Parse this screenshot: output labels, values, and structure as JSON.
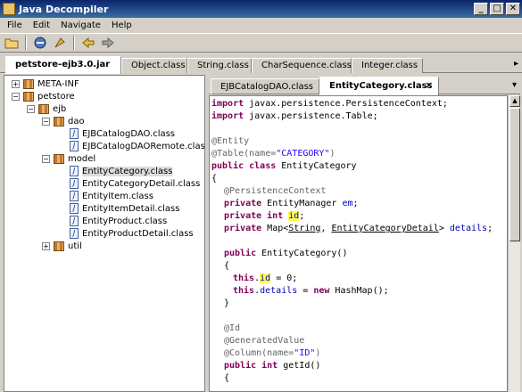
{
  "window": {
    "title": "Java Decompiler",
    "buttons": [
      "_",
      "□",
      "✕"
    ]
  },
  "menu": [
    "File",
    "Edit",
    "Navigate",
    "Help"
  ],
  "toolbar_icons": [
    "open-file-icon",
    "save-icon",
    "search-icon",
    "back-icon",
    "forward-icon"
  ],
  "file_tabs": [
    "petstore-ejb3.0.jar",
    "Object.class",
    "String.class",
    "CharSequence.class",
    "Integer.class"
  ],
  "tree": {
    "meta_inf": "META-INF",
    "petstore": "petstore",
    "ejb": "ejb",
    "dao": "dao",
    "dao_items": [
      "EJBCatalogDAO.class",
      "EJBCatalogDAORemote.class"
    ],
    "model": "model",
    "model_items": [
      "EntityCategory.class",
      "EntityCategoryDetail.class",
      "EntityItem.class",
      "EntityItemDetail.class",
      "EntityProduct.class",
      "EntityProductDetail.class"
    ],
    "util": "util"
  },
  "inner_tabs": [
    "EJBCatalogDAO.class",
    "EntityCategory.class"
  ],
  "code": {
    "l1_kw": "import",
    "l1_rest": " javax.persistence.PersistenceContext;",
    "l2_kw": "import",
    "l2_rest": " javax.persistence.Table;",
    "l3_ann": "@Entity",
    "l4_ann": "@Table(name=",
    "l4_str": "\"CATEGORY\"",
    "l4_end": ")",
    "l5_kw": "public class",
    "l5_rest": " EntityCategory",
    "l6": "{",
    "l7_ann": "@PersistenceContext",
    "l8_kw": "private",
    "l8_rest": " EntityManager ",
    "l8_fld": "em",
    "l8_end": ";",
    "l9_kw": "private int",
    "l9_sp": " ",
    "l9_fld": "id",
    "l9_end": ";",
    "l10_kw": "private",
    "l10_a": " Map<",
    "l10_t1": "String",
    "l10_b": ", ",
    "l10_t2": "EntityCategoryDetail",
    "l10_c": "> ",
    "l10_fld": "details",
    "l10_end": ";",
    "l11_kw": "public",
    "l11_rest": " EntityCategory()",
    "l12": "{",
    "l13_kw": "this",
    "l13_dot": ".",
    "l13_fld": "id",
    "l13_end": " = 0;",
    "l14_kw": "this",
    "l14_dot": ".",
    "l14_fld": "details",
    "l14_mid": " = ",
    "l14_kw2": "new",
    "l14_end": " HashMap();",
    "l15": "}",
    "l16_ann": "@Id",
    "l17_ann": "@GeneratedValue",
    "l18_ann": "@Column(name=",
    "l18_str": "\"ID\"",
    "l18_end": ")",
    "l19_kw": "public int",
    "l19_rest": " getId()",
    "l20": "{"
  }
}
